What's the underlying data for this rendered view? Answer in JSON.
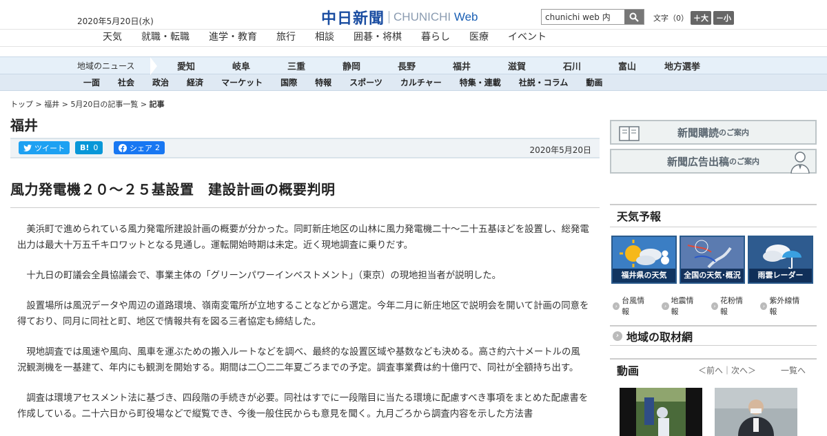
{
  "header": {
    "date": "2020年5月20日(水)",
    "logo_ja": "中日新聞",
    "logo_en_a": "CHUNICHI ",
    "logo_en_b": "Web",
    "search_value": "chunichi web 内",
    "font_size_label": "文字（0）",
    "font_bigger": "＋大",
    "font_smaller": "－小"
  },
  "category_nav": [
    "天気",
    "就職・転職",
    "進学・教育",
    "旅行",
    "相談",
    "囲碁・将棋",
    "暮らし",
    "医療",
    "イベント"
  ],
  "region_nav": {
    "label": "地域のニュース",
    "items": [
      "愛知",
      "岐阜",
      "三重",
      "静岡",
      "長野",
      "福井",
      "滋賀",
      "石川",
      "富山",
      "地方選挙"
    ]
  },
  "genre_nav": [
    "一面",
    "社会",
    "政治",
    "経済",
    "マーケット",
    "国際",
    "特報",
    "スポーツ",
    "カルチャー",
    "特集・連載",
    "社説・コラム",
    "動画"
  ],
  "breadcrumb": {
    "items": [
      "トップ",
      "福井",
      "5月20日の記事一覧"
    ],
    "current": "記事",
    "separator": " > "
  },
  "section_title": "福井",
  "share": {
    "tweet": "ツイート",
    "hatena_label": "B!",
    "hatena_count": "0",
    "facebook": "シェア",
    "facebook_count": "2",
    "date": "2020年5月20日"
  },
  "article": {
    "headline": "風力発電機２０～２５基設置　建設計画の概要判明",
    "paragraphs": [
      "美浜町で進められている風力発電所建設計画の概要が分かった。同町新庄地区の山林に風力発電機二十～二十五基ほどを設置し、総発電出力は最大十万五千キロワットとなる見通し。運転開始時期は未定。近く現地調査に乗りだす。",
      "十九日の町議会全員協議会で、事業主体の「グリーンパワーインベストメント」（東京）の現地担当者が説明した。",
      "設置場所は風況データや周辺の道路環境、嶺南変電所が立地することなどから選定。今年二月に新庄地区で説明会を開いて計画の同意を得ており、同月に同社と町、地区で情報共有を図る三者協定も締結した。",
      "現地調査では風速や風向、風車を運ぶための搬入ルートなどを調べ、最終的な設置区域や基数なども決める。高さ約六十メートルの風況観測機を一基建て、年内にも観測を開始する。期間は二〇二二年夏ごろまでの予定。調査事業費は約十億円で、同社が全額持ち出す。",
      "調査は環境アセスメント法に基づき、四段階の手続きが必要。同社はすでに一段階目に当たる環境に配慮すべき事項をまとめた配慮書を作成している。二十六日から町役場などで縦覧でき、今後一般住民からも意見を聞く。九月ごろから調査内容を示した方法書"
    ]
  },
  "sidebar": {
    "banner1_main": "新聞購読",
    "banner1_sub": "のご案内",
    "banner2_main": "新聞広告出稿",
    "banner2_sub": "のご案内",
    "weather_title": "天気予報",
    "weather_tiles": [
      "福井県の天気",
      "全国の天気･概況",
      "雨雲レーダー"
    ],
    "weather_links": [
      "台風情報",
      "地震情報",
      "花粉情報",
      "紫外線情報"
    ],
    "region_network": "地域の取材網",
    "video_title": "動画",
    "video_nav": "＜前へ｜次へ＞",
    "video_all": "一覧へ"
  }
}
